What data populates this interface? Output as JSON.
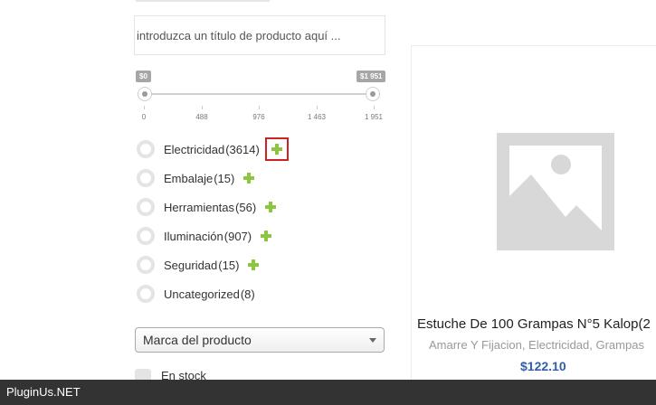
{
  "search": {
    "placeholder": "introduzca un título de producto aquí ..."
  },
  "price_filter": {
    "min_label": "$0",
    "max_label": "$1 951",
    "ticks": [
      "0",
      "488",
      "976",
      "1 463",
      "1 951"
    ],
    "selected_min": 0,
    "selected_max": 1951
  },
  "categories": [
    {
      "name": "Electricidad",
      "count": "(3614)"
    },
    {
      "name": "Embalaje",
      "count": "(15)"
    },
    {
      "name": "Herramientas",
      "count": "(56)"
    },
    {
      "name": "Iluminación",
      "count": "(907)"
    },
    {
      "name": "Seguridad",
      "count": "(15)"
    },
    {
      "name": "Uncategorized",
      "count": "(8)"
    }
  ],
  "brand_select": {
    "value": "Marca del producto"
  },
  "stock": {
    "label": "En stock"
  },
  "product": {
    "title": "Estuche De 100 Grampas N°5 Kalop(2",
    "categories": "Amarre Y Fijacion, Electricidad, Grampas",
    "price": "$122.10"
  },
  "footer": {
    "text": "PluginUs.NET"
  },
  "colors": {
    "plus_icon": "#8cc63f",
    "highlight_box": "#cc2222",
    "price": "#2f5fa8",
    "footer_bg": "#333333"
  }
}
